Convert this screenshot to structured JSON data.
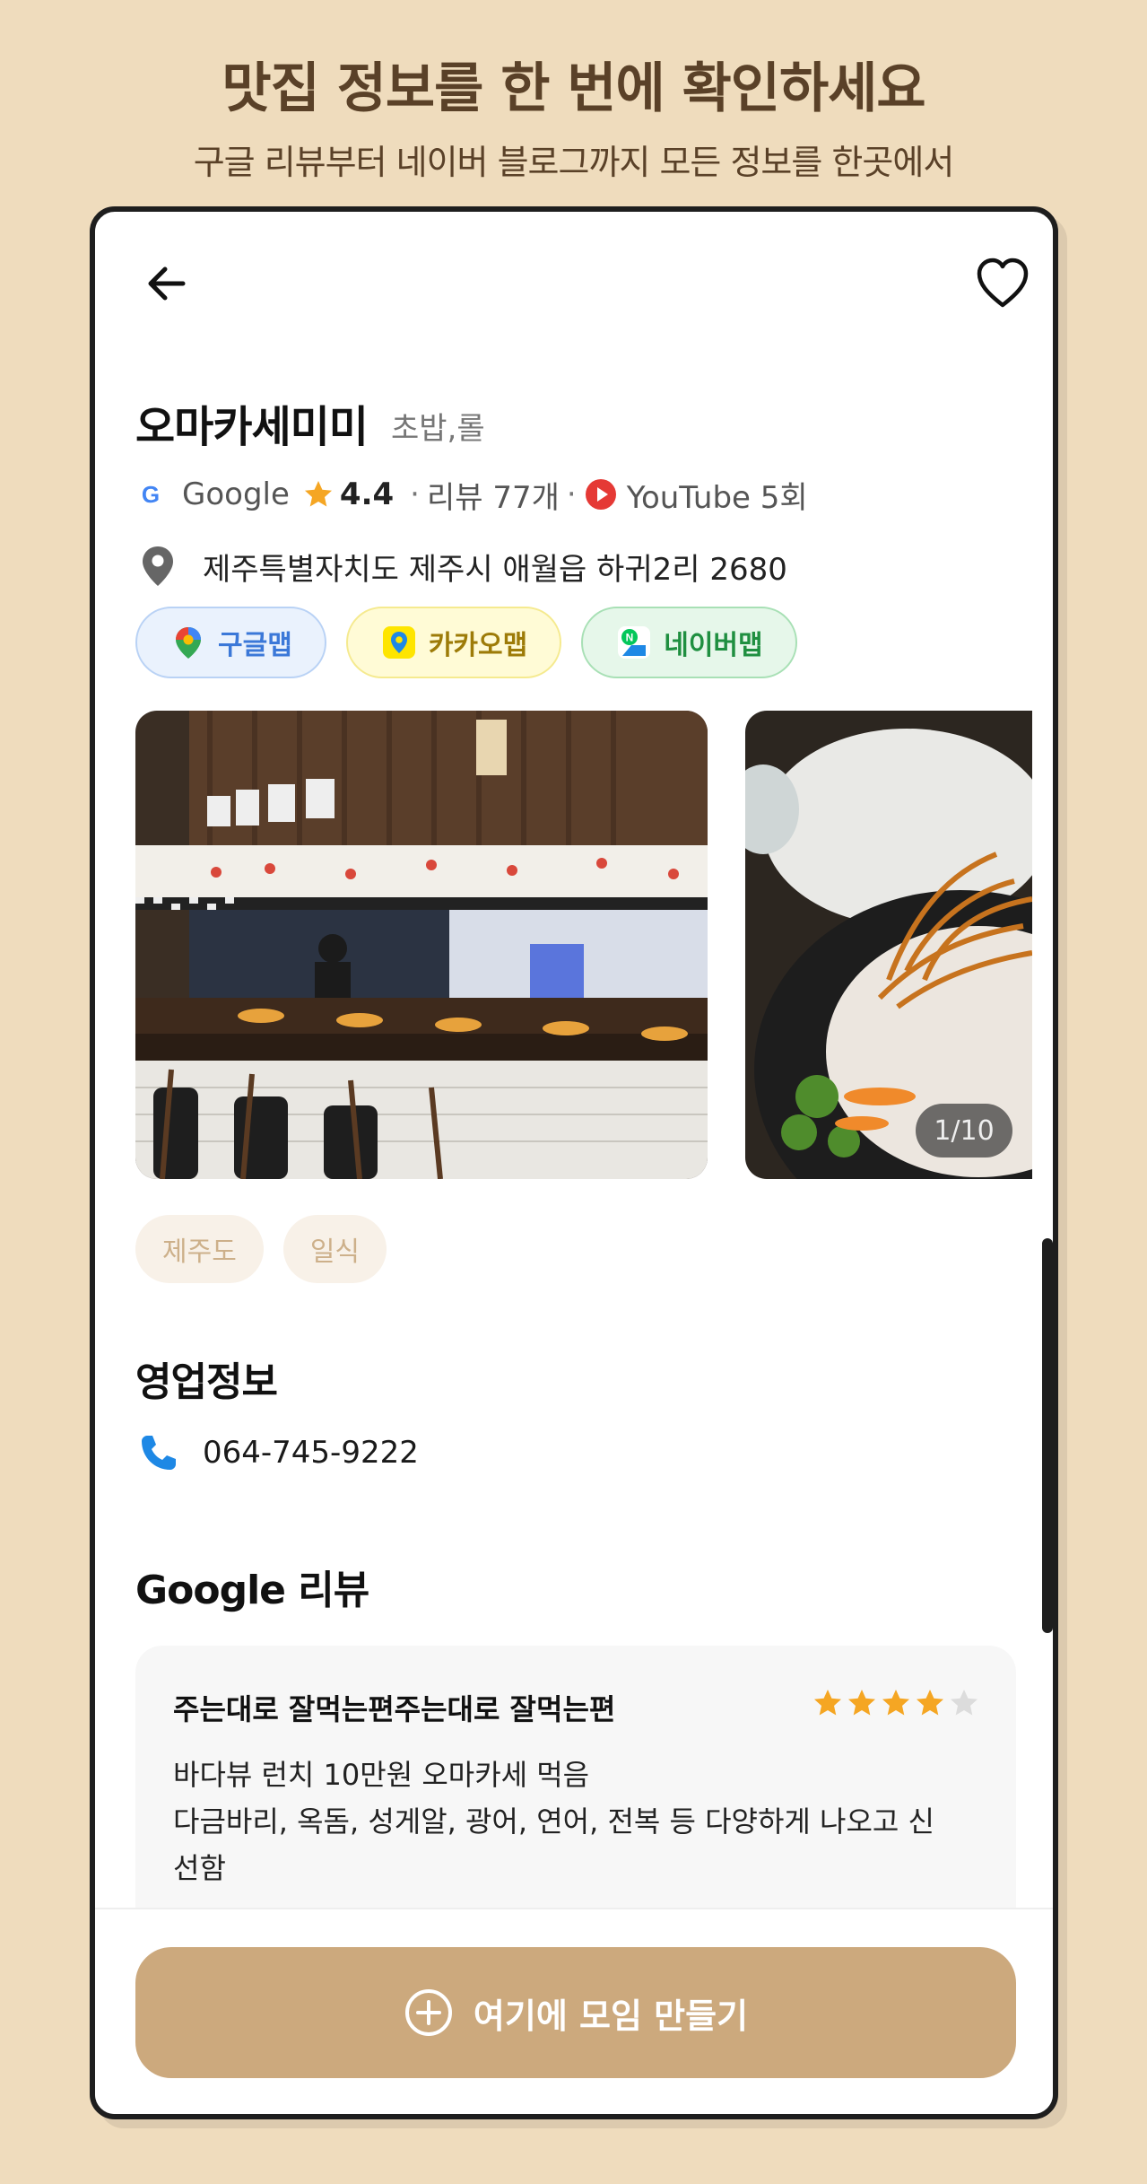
{
  "promo": {
    "title": "맛집 정보를 한 번에 확인하세요",
    "subtitle": "구글 리뷰부터 네이버 블로그까지 모든 정보를 한곳에서"
  },
  "header": {
    "back_icon": "arrow-left-icon",
    "favorite_icon": "heart-outline-icon"
  },
  "place": {
    "name": "오마카세미미",
    "category": "초밥,롤",
    "rating_source": "Google",
    "rating": "4.4",
    "separator": "·",
    "review_count": "리뷰 77개",
    "youtube": "YouTube 5회",
    "address": "제주특별자치도 제주시 애월읍 하귀2리 2680"
  },
  "map_links": [
    {
      "label": "구글맵",
      "icon": "google-maps-icon",
      "color": "#3b78d8"
    },
    {
      "label": "카카오맵",
      "icon": "kakao-map-icon",
      "color": "#9d7b08"
    },
    {
      "label": "네이버맵",
      "icon": "naver-map-icon",
      "color": "#1f8f40"
    }
  ],
  "gallery": {
    "counter": "1/10",
    "current": 1,
    "total": 10
  },
  "tags": [
    "제주도",
    "일식"
  ],
  "business_info": {
    "title": "영업정보",
    "phone": "064-745-9222"
  },
  "google_reviews": {
    "title": "Google 리뷰",
    "reviews": [
      {
        "author": "주는대로 잘먹는편주는대로 잘먹는편",
        "rating": 4,
        "max_rating": 5,
        "text_line1": "바다뷰 런치 10만원 오마카세 먹음",
        "text_line2": "다금바리, 옥돔, 성게알, 광어, 연어, 전복 등 다양하게 나오고 신",
        "text_line3": "선함"
      }
    ]
  },
  "cta": {
    "label": "여기에 모임 만들기"
  },
  "colors": {
    "background": "#efdcbd",
    "accent": "#cca97d",
    "star": "#f5a623",
    "promo_text": "#5a4128"
  }
}
